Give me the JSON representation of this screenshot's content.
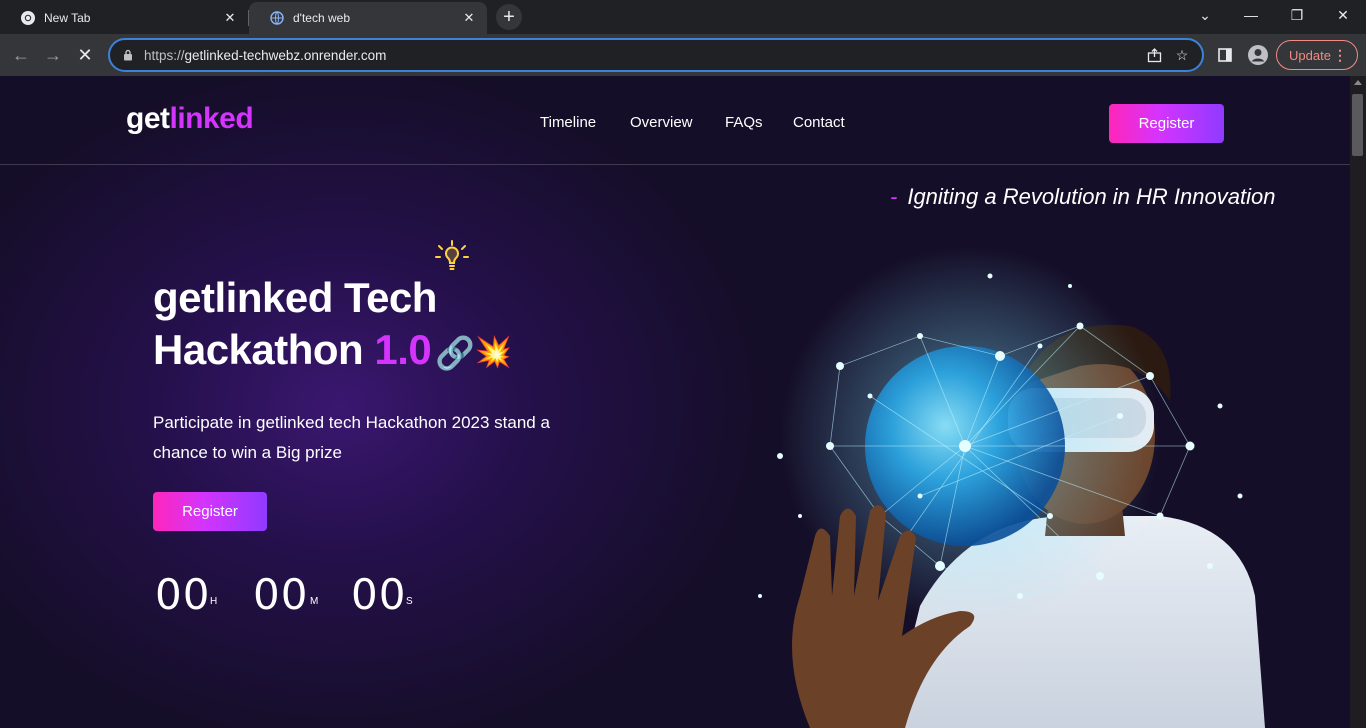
{
  "browser": {
    "tabs": [
      {
        "title": "New Tab",
        "active": false,
        "icon": "chrome-icon"
      },
      {
        "title": "d'tech web",
        "active": true,
        "icon": "globe-icon"
      }
    ],
    "url_scheme": "https://",
    "url_host": "getlinked-techwebz.onrender.com",
    "update_label": "Update",
    "accent_color": "#3b82d8",
    "update_color": "#f28b82"
  },
  "site": {
    "logo_main": "get",
    "logo_accent": "linked",
    "nav": [
      "Timeline",
      "Overview",
      "FAQs",
      "Contact"
    ],
    "header_register": "Register",
    "tagline": "Igniting a Revolution in HR Innovation",
    "headline_line1": "getlinked Tech",
    "headline_line2": "Hackathon",
    "headline_version": "1.0",
    "emoji_chain": "🔗",
    "emoji_burst": "💥",
    "subtext": "Participate in getlinked tech Hackathon 2023 stand a chance to win a Big prize",
    "hero_register": "Register",
    "timer": {
      "hours": "00",
      "hours_unit": "H",
      "minutes": "00",
      "minutes_unit": "M",
      "seconds": "00",
      "seconds_unit": "S"
    },
    "colors": {
      "accent": "#d434fe",
      "gradient": [
        "#903aff",
        "#d434fe",
        "#ff26b9"
      ],
      "background": "#150e28"
    }
  }
}
